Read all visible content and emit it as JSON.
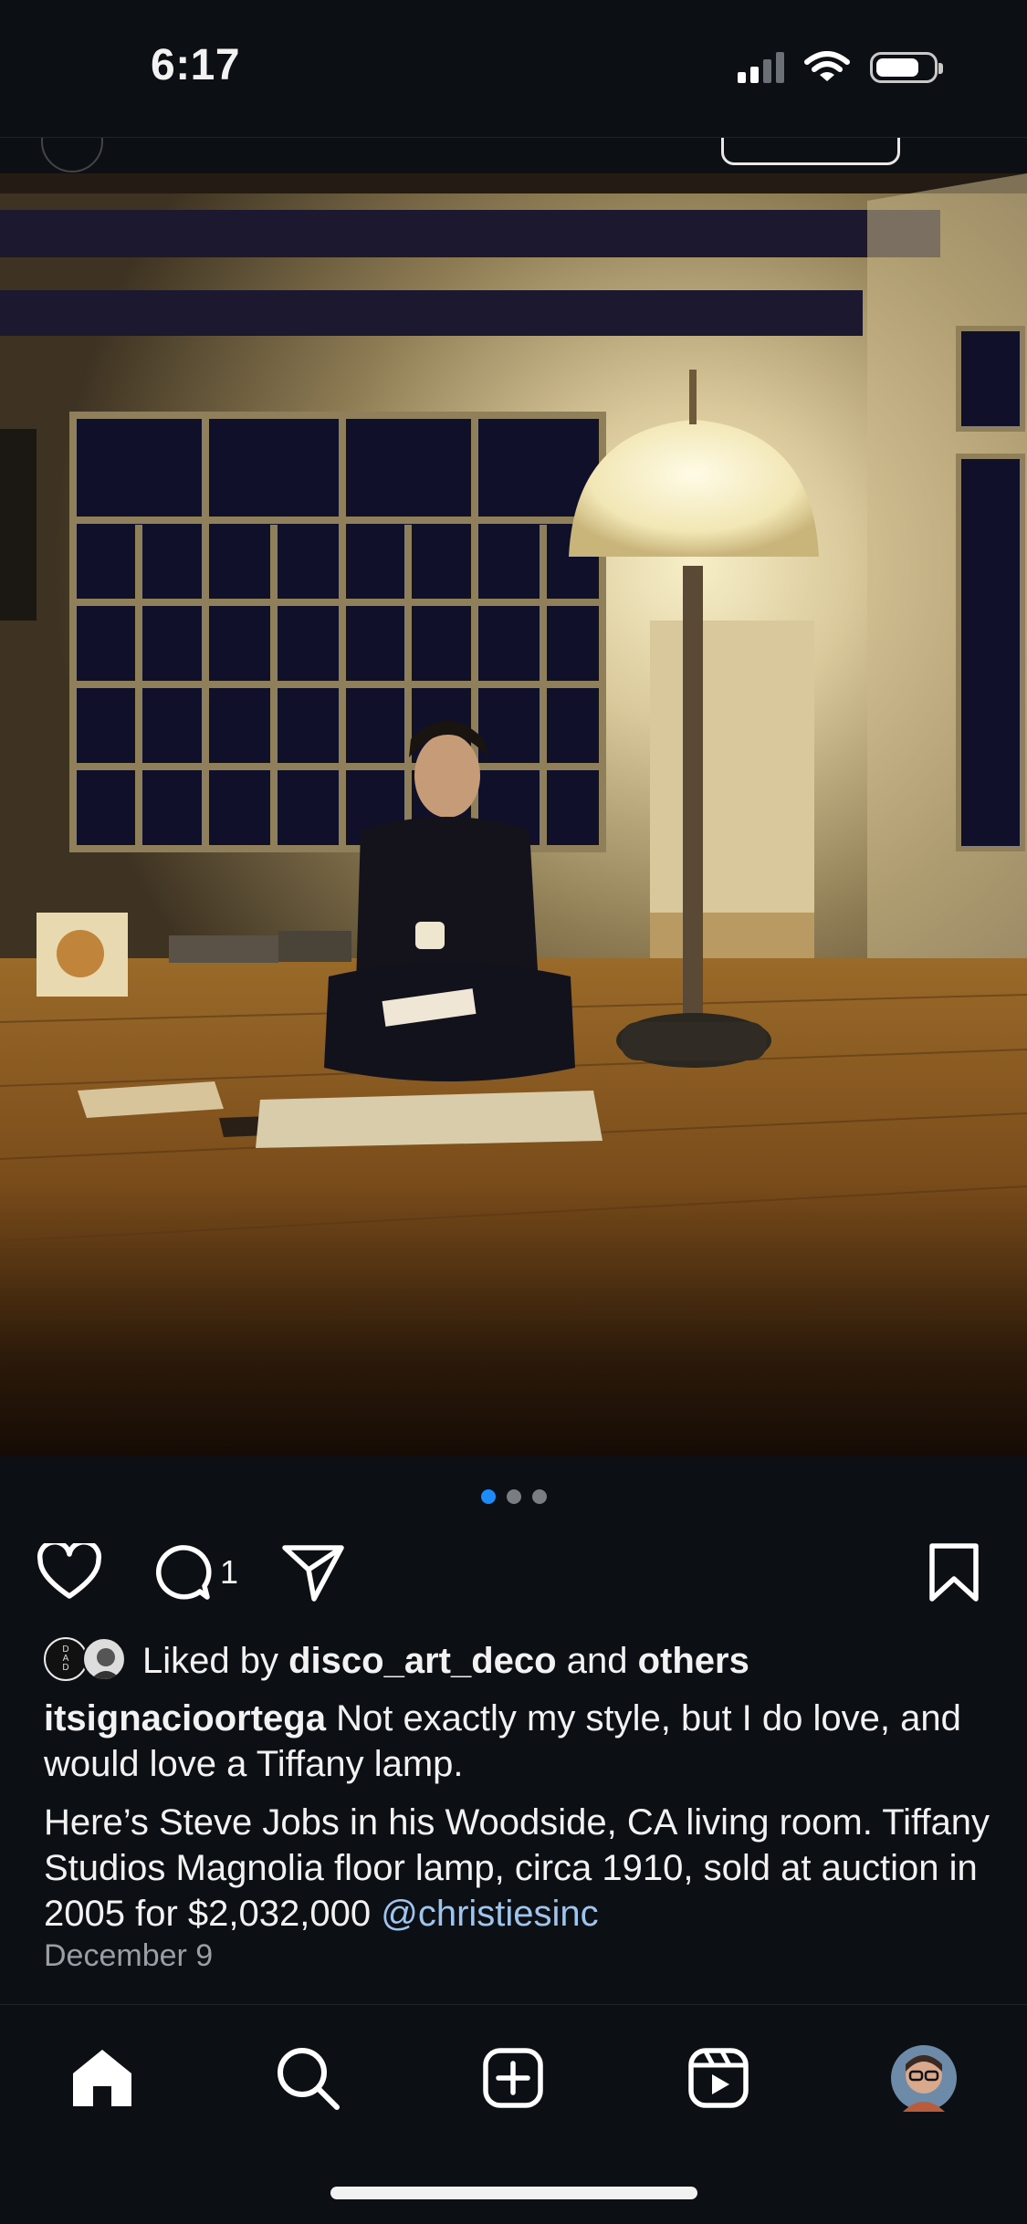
{
  "status_bar": {
    "time": "6:17"
  },
  "post": {
    "image_alt": "Photo of a man seated on a rug in a dim living room beside a glowing floor lamp",
    "carousel": {
      "count": 3,
      "active": 1
    },
    "comment_count": "1",
    "likes": {
      "prefix": "Liked by",
      "user": "disco_art_deco",
      "joiner": "and",
      "others": "others",
      "avatar_text": "D A D"
    },
    "caption": {
      "username": "itsignacioortega",
      "line1": "Not exactly my style, but I do love, and would love a Tiffany lamp.",
      "line2": "Here’s Steve Jobs in his Woodside, CA living room. Tiffany Studios Magnolia floor lamp, circa 1910, sold at auction in 2005 for $2,032,000",
      "mention": "@christiesinc"
    },
    "date": "December 9"
  },
  "icons": {
    "like": "heart-icon",
    "comment": "comment-bubble-icon",
    "share": "paper-plane-icon",
    "save": "bookmark-icon"
  },
  "tabbar": {
    "items": [
      "home-icon",
      "search-icon",
      "create-post-icon",
      "reels-icon",
      "profile-avatar"
    ]
  },
  "colors": {
    "background": "#0c0f14",
    "accent": "#1d8cf8",
    "mention": "#9fc4ee"
  }
}
